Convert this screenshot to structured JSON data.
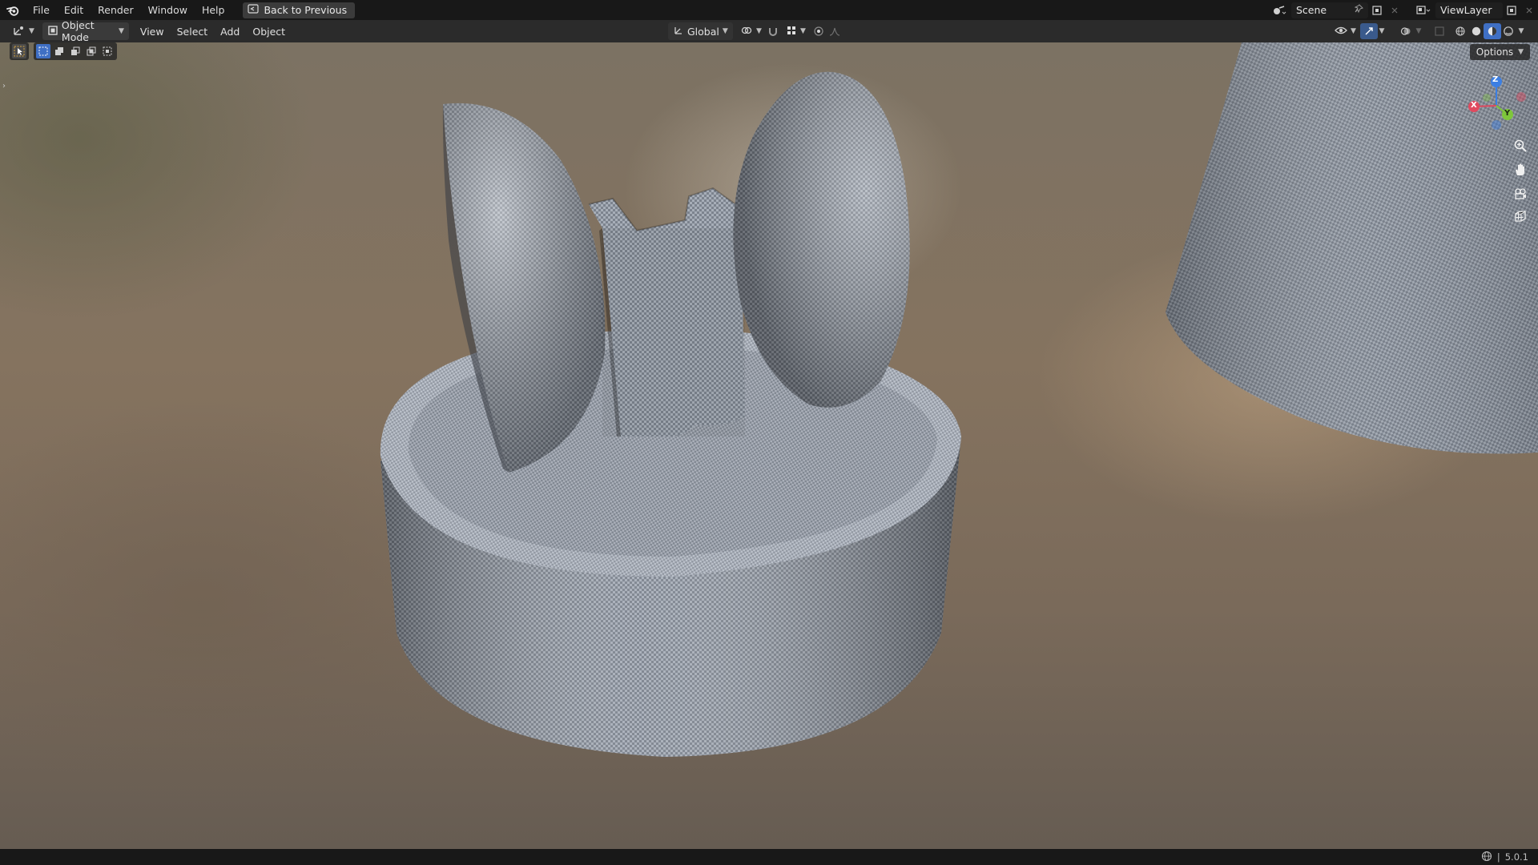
{
  "menu": {
    "items": [
      "File",
      "Edit",
      "Render",
      "Window",
      "Help"
    ],
    "back_button": "Back to Previous"
  },
  "scene": {
    "label": "Scene"
  },
  "view_layer": {
    "label": "ViewLayer"
  },
  "viewport_header": {
    "mode": "Object Mode",
    "menus": [
      "View",
      "Select",
      "Add",
      "Object"
    ],
    "transform_orientation": "Global"
  },
  "viewport": {
    "options_label": "Options",
    "gizmo_axes": {
      "z": "Z",
      "x": "X",
      "y": "Y"
    },
    "colors": {
      "x_axis": "#e04a5f",
      "y_axis": "#7ec63a",
      "z_axis": "#3c7fe3"
    }
  },
  "status": {
    "version": "5.0.1",
    "separator": "|"
  }
}
